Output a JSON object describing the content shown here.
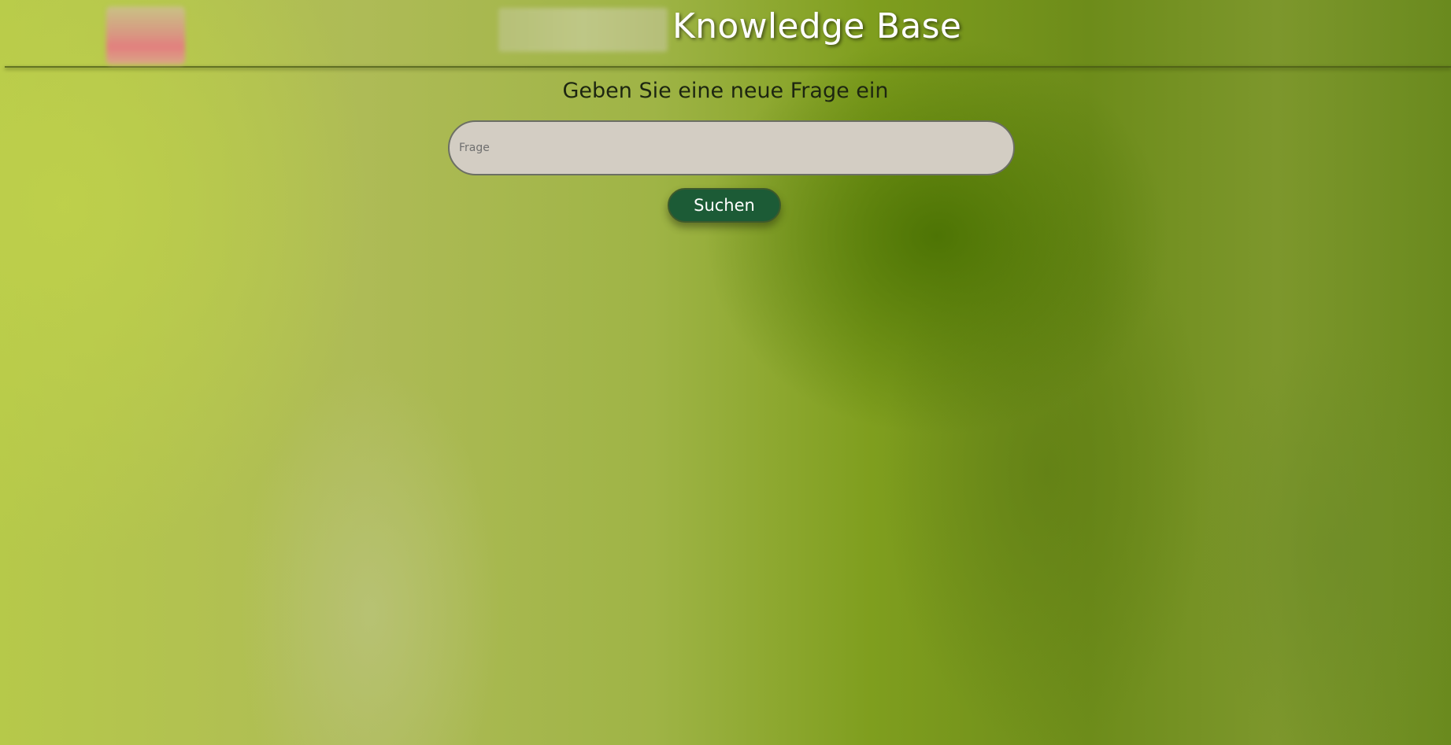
{
  "header": {
    "title": "Knowledge Base"
  },
  "main": {
    "heading": "Geben Sie eine neue Frage ein",
    "question_input": {
      "placeholder": "Frage",
      "value": ""
    },
    "search_button_label": "Suchen"
  },
  "colors": {
    "button_background": "#1c5b36",
    "input_background": "#d3cdc3",
    "title_text": "#ffffff",
    "heading_text": "#1d2611"
  }
}
